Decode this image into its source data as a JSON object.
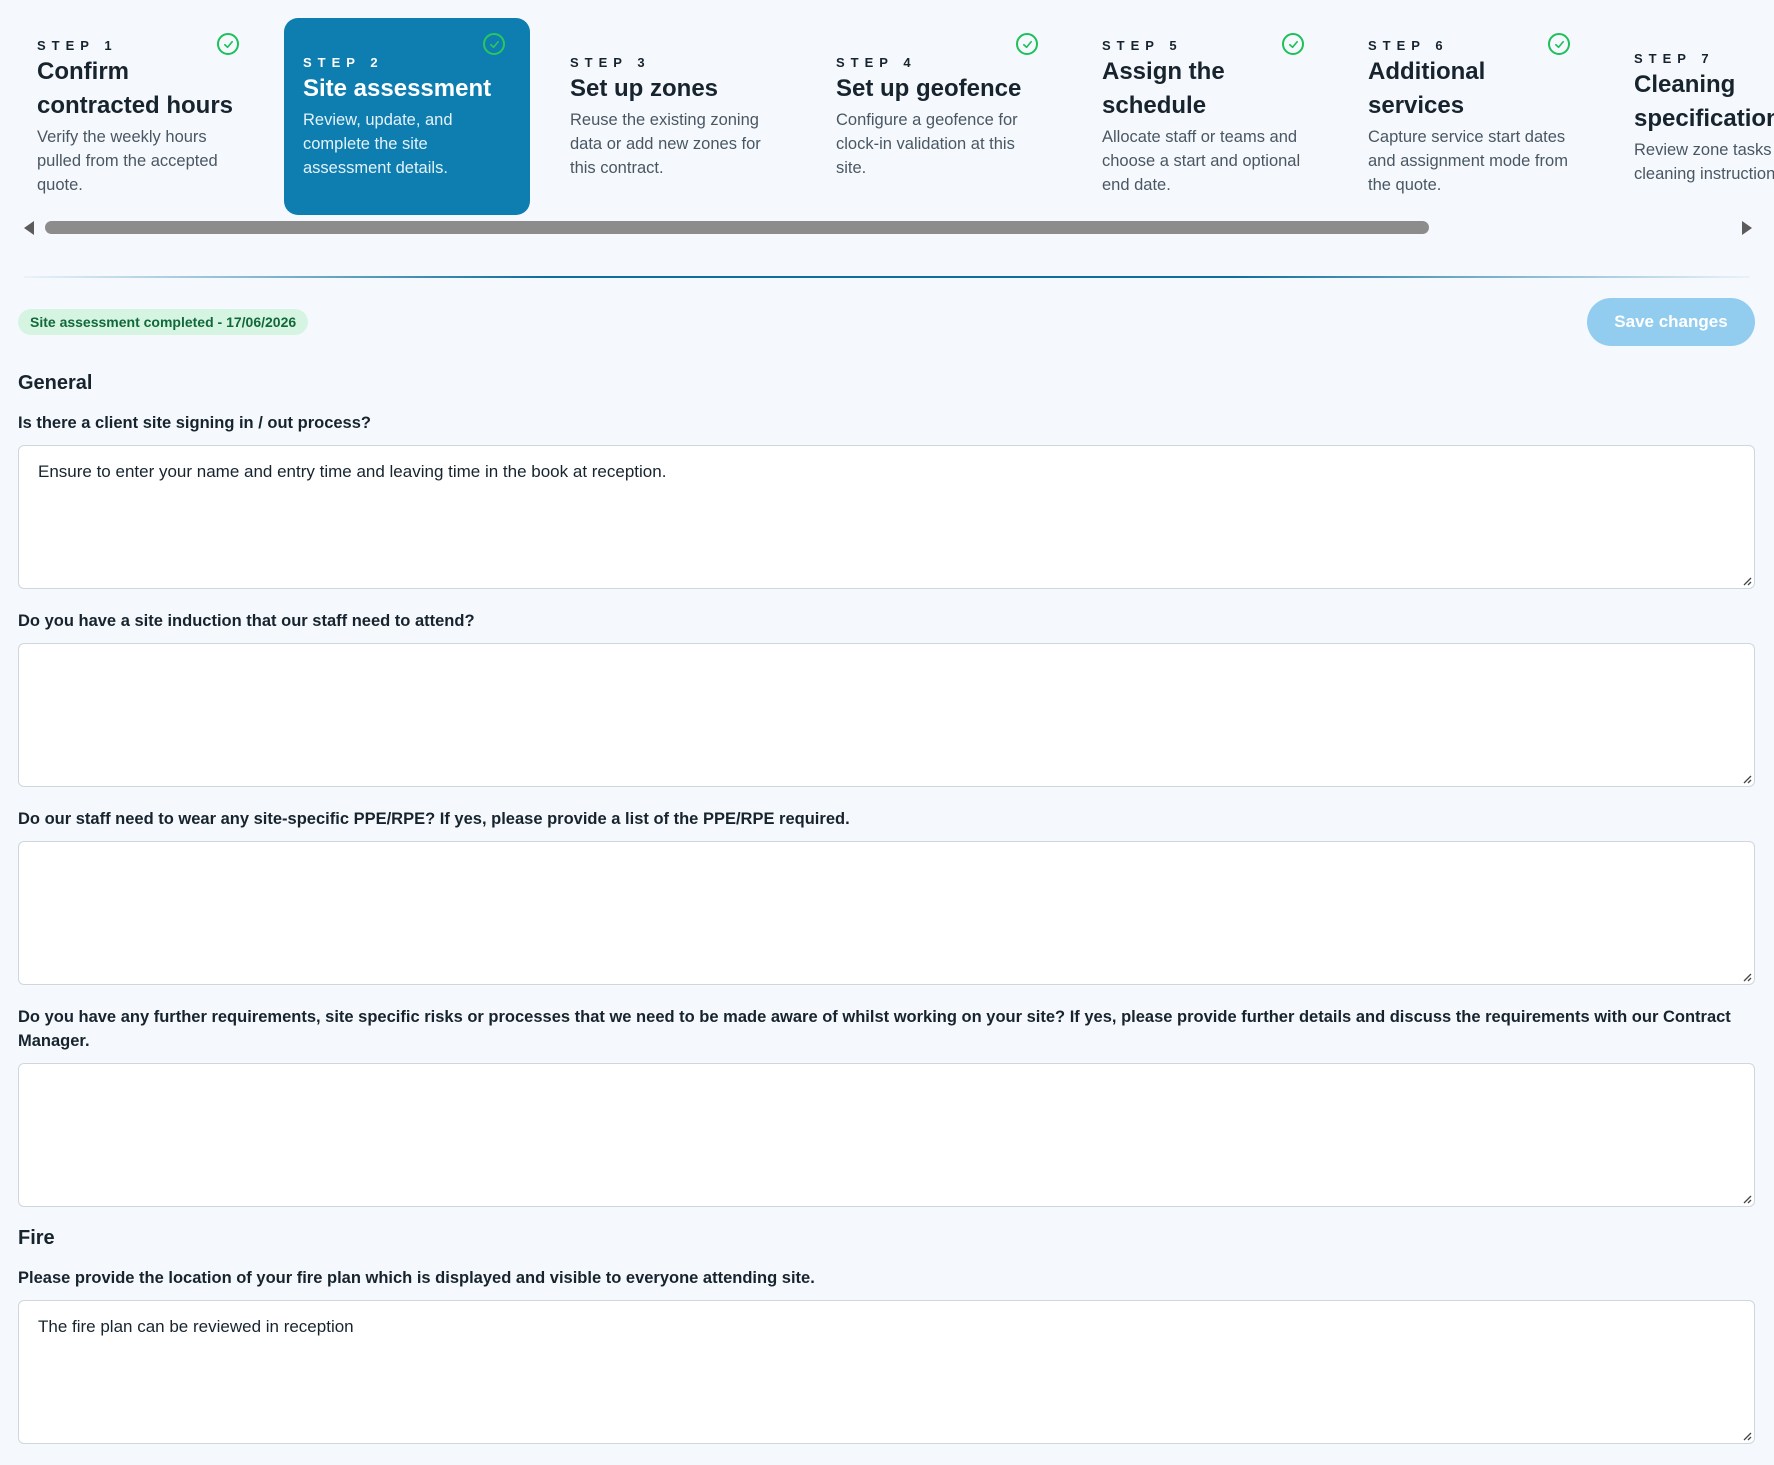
{
  "stepper": {
    "steps": [
      {
        "num": "STEP 1",
        "title": "Confirm contracted hours",
        "desc": "Verify the weekly hours pulled from the accepted quote.",
        "completed": true,
        "active": false
      },
      {
        "num": "STEP 2",
        "title": "Site assessment",
        "desc": "Review, update, and complete the site assessment details.",
        "completed": true,
        "active": true
      },
      {
        "num": "STEP 3",
        "title": "Set up zones",
        "desc": "Reuse the existing zoning data or add new zones for this contract.",
        "completed": false,
        "active": false
      },
      {
        "num": "STEP 4",
        "title": "Set up geofence",
        "desc": "Configure a geofence for clock-in validation at this site.",
        "completed": true,
        "active": false
      },
      {
        "num": "STEP 5",
        "title": "Assign the schedule",
        "desc": "Allocate staff or teams and choose a start and optional end date.",
        "completed": true,
        "active": false
      },
      {
        "num": "STEP 6",
        "title": "Additional services",
        "desc": "Capture service start dates and assignment mode from the quote.",
        "completed": true,
        "active": false
      },
      {
        "num": "STEP 7",
        "title": "Cleaning specification",
        "desc": "Review zone tasks and cleaning instructions.",
        "completed": false,
        "active": false
      }
    ]
  },
  "status_badge": "Site assessment completed - 17/06/2026",
  "save_button": "Save changes",
  "sections": {
    "general": {
      "title": "General",
      "questions": [
        {
          "label": "Is there a client site signing in / out process?",
          "answer": "Ensure to enter your name and entry time and leaving time in the book at reception."
        },
        {
          "label": "Do you have a site induction that our staff need to attend?",
          "answer": ""
        },
        {
          "label": "Do our staff need to wear any site-specific PPE/RPE? If yes, please provide a list of the PPE/RPE required.",
          "answer": ""
        },
        {
          "label": "Do you have any further requirements, site specific risks or processes that we need to be made aware of whilst working on your site? If yes, please provide further details and discuss the requirements with our Contract Manager.",
          "answer": ""
        }
      ]
    },
    "fire": {
      "title": "Fire",
      "questions": [
        {
          "label": "Please provide the location of your fire plan which is displayed and visible to everyone attending site.",
          "answer": "The fire plan can be reviewed in reception"
        }
      ]
    }
  },
  "colors": {
    "accent": "#0e7daf",
    "check": "#1fbf5a",
    "badge_bg": "#d5f5e2",
    "badge_text": "#12683b",
    "save_button_bg": "#92cdf0",
    "page_bg": "#f5f9fd"
  }
}
